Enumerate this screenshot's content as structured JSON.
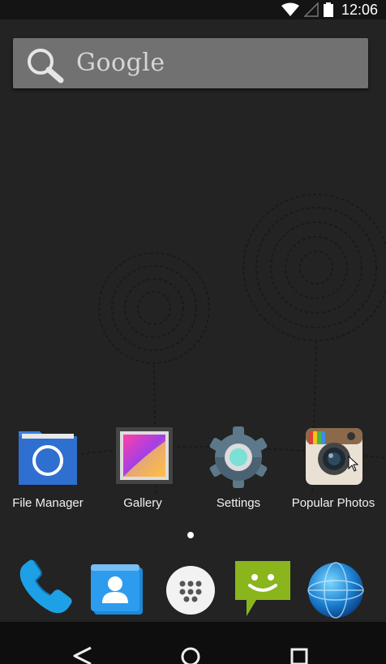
{
  "status": {
    "time": "12:06",
    "icons": [
      "wifi-icon",
      "cell-signal-icon",
      "battery-icon"
    ]
  },
  "search": {
    "label": "Google",
    "icon": "search-icon"
  },
  "apps": [
    {
      "label": "File Manager",
      "icon": "folder-icon"
    },
    {
      "label": "Gallery",
      "icon": "gallery-icon"
    },
    {
      "label": "Settings",
      "icon": "gear-icon"
    },
    {
      "label": "Popular Photos",
      "icon": "camera-icon"
    }
  ],
  "dock": [
    {
      "icon": "phone-icon"
    },
    {
      "icon": "contacts-icon"
    },
    {
      "icon": "app-drawer-icon"
    },
    {
      "icon": "messaging-icon"
    },
    {
      "icon": "browser-globe-icon"
    }
  ],
  "nav": [
    "back-icon",
    "home-icon",
    "recents-icon"
  ],
  "colors": {
    "background": "#232323",
    "search_bar": "#717171",
    "folder_blue": "#2f6fd0",
    "messaging_green": "#8ab51c"
  }
}
